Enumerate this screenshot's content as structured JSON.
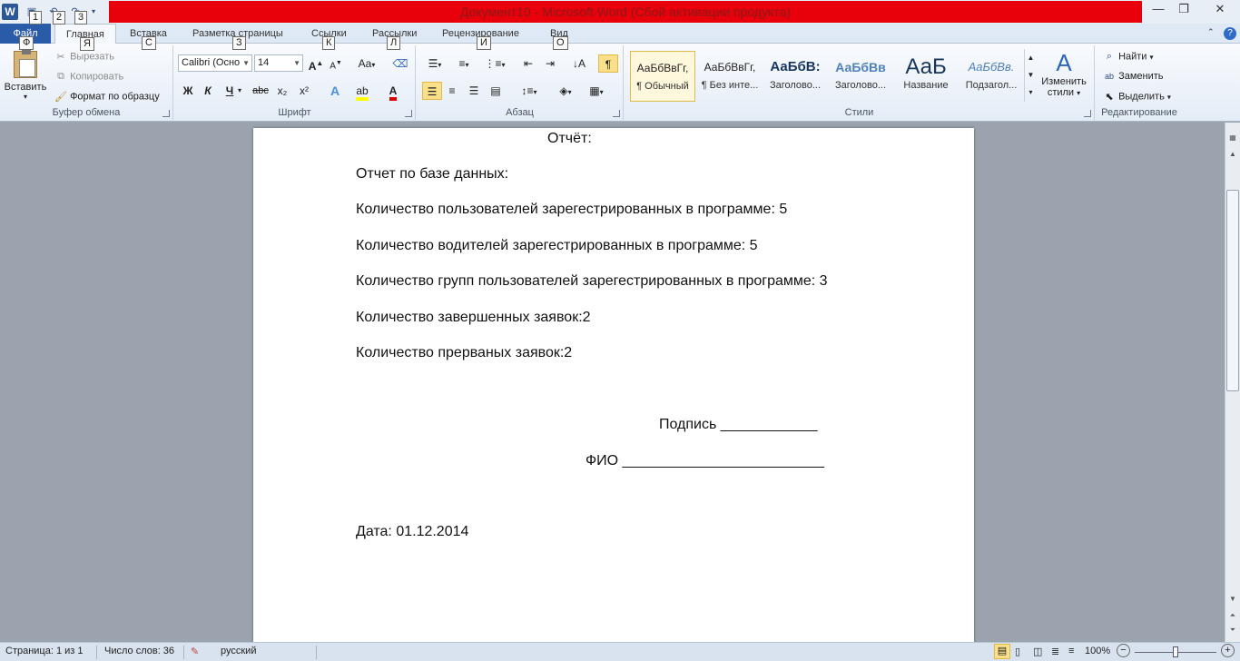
{
  "window": {
    "title": "Документ10  -  Microsoft Word (Сбой активации продукта)",
    "qat_keytips": [
      "1",
      "2",
      "3"
    ],
    "controls": [
      "—",
      "❐",
      "✕"
    ]
  },
  "tabs": [
    {
      "label": "Файл",
      "keytip": "Ф"
    },
    {
      "label": "Главная",
      "keytip": "Я"
    },
    {
      "label": "Вставка",
      "keytip": "С"
    },
    {
      "label": "Разметка страницы",
      "keytip": "З"
    },
    {
      "label": "Ссылки",
      "keytip": "К"
    },
    {
      "label": "Рассылки",
      "keytip": "Л"
    },
    {
      "label": "Рецензирование",
      "keytip": "И"
    },
    {
      "label": "Вид",
      "keytip": "О"
    }
  ],
  "ribbon": {
    "clipboard": {
      "label": "Буфер обмена",
      "paste": "Вставить",
      "cut": "Вырезать",
      "copy": "Копировать",
      "format_painter": "Формат по образцу"
    },
    "font": {
      "label": "Шрифт",
      "font_name": "Calibri (Осно",
      "font_size": "14",
      "bold": "Ж",
      "italic": "К",
      "underline": "Ч",
      "strike": "abc",
      "subscript": "x₂",
      "superscript": "x²",
      "grow": "A",
      "shrink": "A",
      "case": "Aa"
    },
    "paragraph": {
      "label": "Абзац",
      "pilcrow": "¶"
    },
    "styles": {
      "label": "Стили",
      "items": [
        {
          "sample": "АаБбВвГг,",
          "name": "¶ Обычный",
          "color": "#000000"
        },
        {
          "sample": "АаБбВвГг,",
          "name": "¶ Без инте...",
          "color": "#000000"
        },
        {
          "sample": "АаБбВ:",
          "name": "Заголово...",
          "color": "#17365d"
        },
        {
          "sample": "АаБбВв",
          "name": "Заголово...",
          "color": "#4f81bd"
        },
        {
          "sample": "АаБ",
          "name": "Название",
          "color": "#17365d"
        },
        {
          "sample": "АаБбВв.",
          "name": "Подзагол...",
          "color": "#4f81bd"
        }
      ],
      "change_styles": "Изменить",
      "change_styles_2": "стили"
    },
    "editing": {
      "label": "Редактирование",
      "find": "Найти",
      "replace": "Заменить",
      "select": "Выделить"
    }
  },
  "document": {
    "title": "Отчёт:",
    "lines": [
      "Отчет по базе данных:",
      "Количество пользователей зарегестрированных в программе: 5",
      "Количество водителей зарегестрированных в программе: 5",
      "Количество групп пользователей зарегестрированных в программе: 3",
      "Количество завершенных заявок:2",
      "Количество прерваных заявок:2"
    ],
    "signature": "Подпись  ____________",
    "fio": "ФИО  _________________________",
    "date": "Дата: 01.12.2014"
  },
  "status": {
    "page": "Страница: 1 из 1",
    "words": "Число слов: 36",
    "language": "русский",
    "zoom": "100%",
    "zoom_minus": "−",
    "zoom_plus": "+"
  }
}
